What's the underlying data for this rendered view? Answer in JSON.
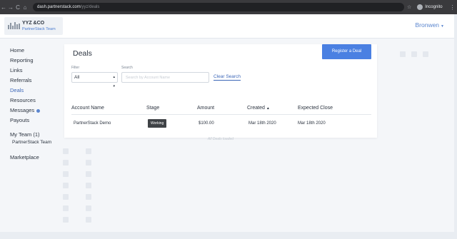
{
  "browser": {
    "nav_back": "←",
    "nav_forward": "→",
    "reload": "C",
    "home": "⌂",
    "url_host": "dash.partnerstack.com",
    "url_path": "/yyz/deals",
    "bookmark_icon": "star-icon",
    "incognito_label": "Incognito",
    "menu_icon": "⋮"
  },
  "header": {
    "brand_name": "YYZ &CO",
    "brand_team": "PartnerStack Team",
    "user_name": "Bronwen",
    "user_caret": "▼"
  },
  "sidebar": {
    "items": [
      {
        "label": "Home"
      },
      {
        "label": "Reporting"
      },
      {
        "label": "Links"
      },
      {
        "label": "Referrals"
      },
      {
        "label": "Deals"
      },
      {
        "label": "Resources"
      },
      {
        "label": "Messages"
      },
      {
        "label": "Payouts"
      }
    ],
    "team_heading": "My Team (1)",
    "team_member": "PartnerStack Team",
    "marketplace": "Marketplace"
  },
  "main": {
    "title": "Deals",
    "register_button": "Register a Deal",
    "filter_label": "Filter",
    "filter_value": "All",
    "filter_chevron": "▲▼",
    "search_label": "Search",
    "search_placeholder": "Search by Account Name",
    "clear_search": "Clear Search",
    "columns": [
      "Account Name",
      "Stage",
      "Amount",
      "Created",
      "Expected Close"
    ],
    "sort_indicator": "▲",
    "rows": [
      {
        "account_name": "PartnerStack Demo",
        "stage": "Working",
        "amount": "$100.00",
        "created": "Mar 18th 2020",
        "expected_close": "Mar 18th 2020"
      }
    ],
    "footer_note": "All Deals loaded"
  },
  "colors": {
    "accent": "#4a80e2",
    "link": "#3d67b8",
    "stage_badge": "#3f4246",
    "browser_chrome": "#3a3a3d"
  }
}
